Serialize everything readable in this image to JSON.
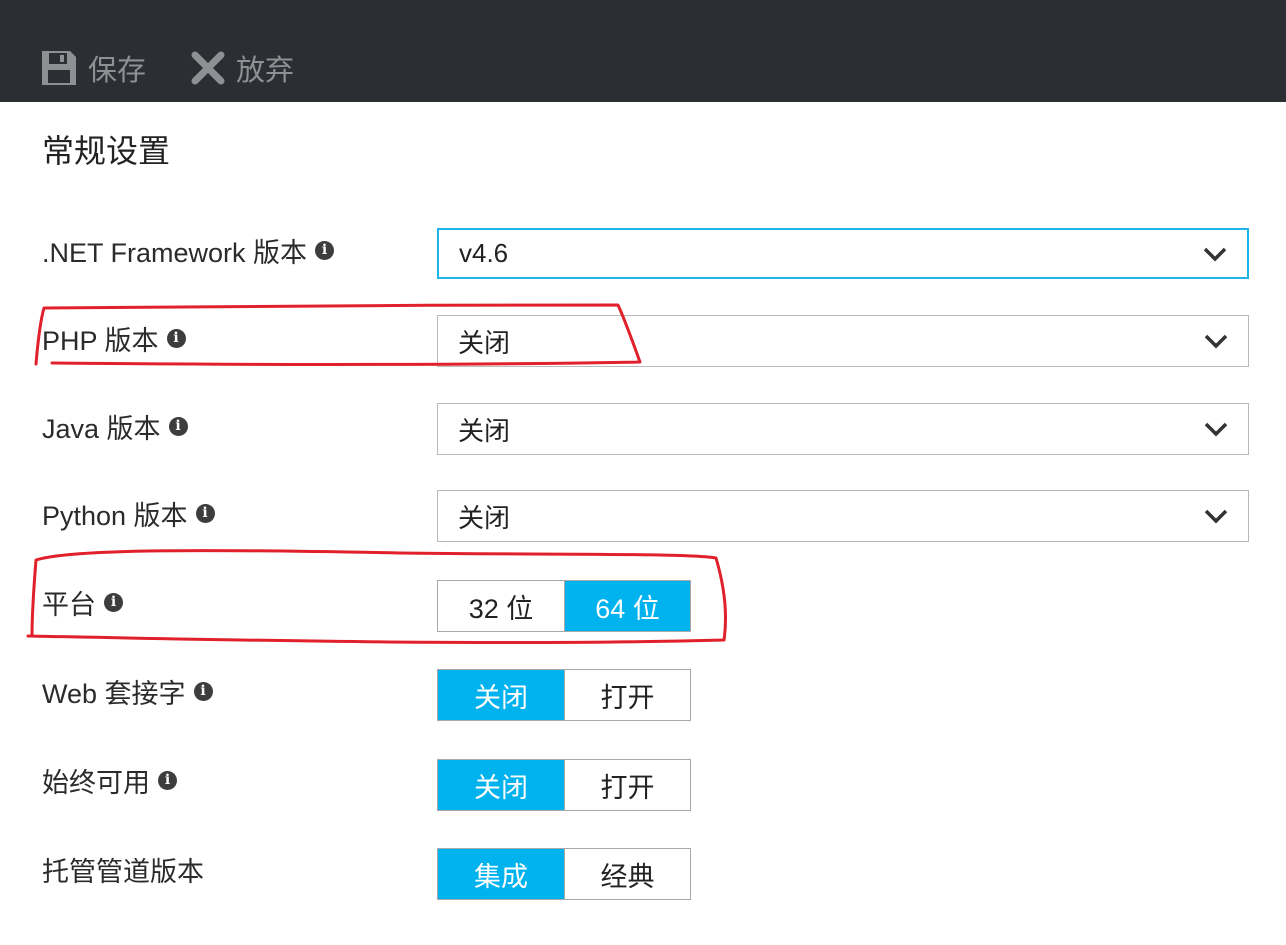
{
  "toolbar": {
    "save_label": "保存",
    "discard_label": "放弃"
  },
  "section_title": "常规设置",
  "settings": {
    "dotnet": {
      "label": ".NET Framework 版本",
      "value": "v4.6"
    },
    "php": {
      "label": "PHP 版本",
      "value": "关闭"
    },
    "java": {
      "label": "Java 版本",
      "value": "关闭"
    },
    "python": {
      "label": "Python 版本",
      "value": "关闭"
    },
    "platform": {
      "label": "平台",
      "options": [
        "32 位",
        "64 位"
      ],
      "selected": "64 位"
    },
    "websocket": {
      "label": "Web 套接字",
      "options": [
        "关闭",
        "打开"
      ],
      "selected": "关闭"
    },
    "always_on": {
      "label": "始终可用",
      "options": [
        "关闭",
        "打开"
      ],
      "selected": "关闭"
    },
    "pipeline": {
      "label": "托管管道版本",
      "options": [
        "集成",
        "经典"
      ],
      "selected": "集成"
    }
  },
  "info_glyph": "i",
  "icons": {
    "save": "floppy-disk-icon",
    "discard": "close-icon",
    "dropdown": "chevron-down-icon",
    "info": "info-circle-icon"
  },
  "colors": {
    "toolbar_bg": "#2b2f33",
    "accent": "#00b2ee",
    "focus_border": "#1fb3e6",
    "annotation": "#e0202a"
  }
}
